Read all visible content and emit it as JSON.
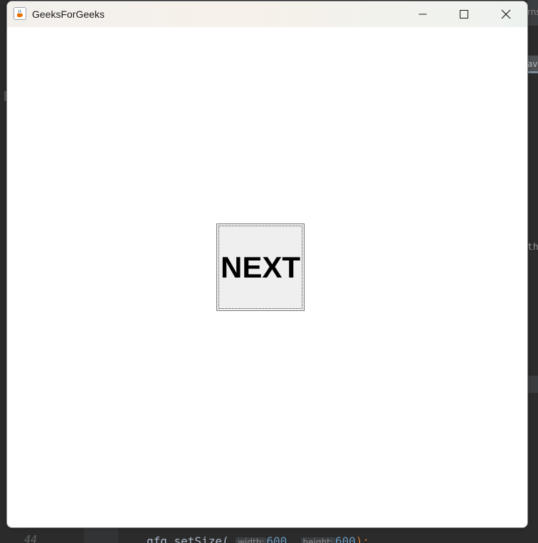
{
  "window": {
    "title": "GeeksForGeeks",
    "icon": "java-cup-icon"
  },
  "controls": {
    "minimize_icon": "minimize-icon",
    "maximize_icon": "maximize-icon",
    "close_icon": "close-icon"
  },
  "content": {
    "button_label": "NEXT"
  },
  "background_ide": {
    "top_right_text": "rns",
    "tab_text": "ava",
    "side_text": "th",
    "line_number": "44",
    "code_prefix": "gfg.setSize(",
    "hint_width": "width:",
    "value_width": "600",
    "hint_height": "height:",
    "value_height": "600",
    "code_suffix": ");"
  },
  "colors": {
    "ide_background": "#2b2b2b",
    "window_background": "#ffffff",
    "button_face": "#efefef",
    "button_text": "#000000"
  }
}
